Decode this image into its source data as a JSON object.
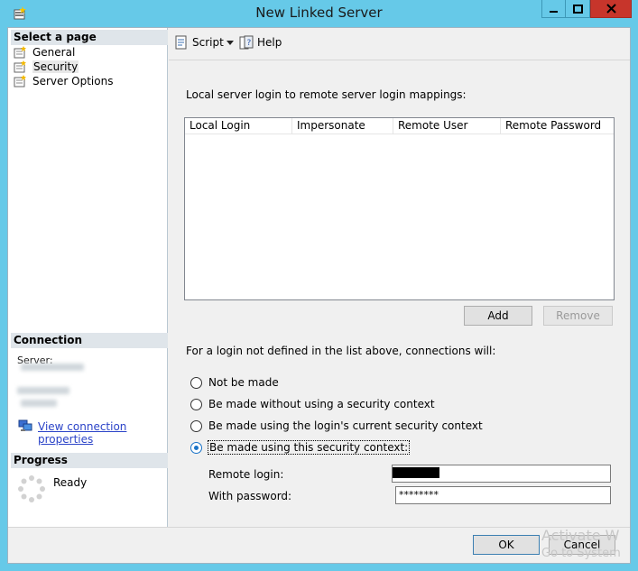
{
  "window": {
    "title": "New Linked Server"
  },
  "left": {
    "select_page": "Select a page",
    "pages": [
      "General",
      "Security",
      "Server Options"
    ],
    "connection": {
      "header": "Connection",
      "server_label": "Server:",
      "link": "View connection properties"
    },
    "progress": {
      "header": "Progress",
      "status": "Ready"
    }
  },
  "toolbar": {
    "script": "Script",
    "help": "Help"
  },
  "main": {
    "mapping_label": "Local server login to remote server login mappings:",
    "columns": [
      "Local Login",
      "Impersonate",
      "Remote User",
      "Remote Password"
    ],
    "add": "Add",
    "remove": "Remove",
    "undefined_label": "For a login not defined in the list above, connections will:",
    "options": [
      "Not be made",
      "Be made without using a security context",
      "Be made using the login's current security context",
      "Be made using this security context:"
    ],
    "selected_option_index": 3,
    "remote_login_label": "Remote login:",
    "password_label": "With password:",
    "password_value": "********"
  },
  "footer": {
    "ok": "OK",
    "cancel": "Cancel"
  },
  "watermark": {
    "line1": "Activate W",
    "line2": "Go to System"
  }
}
